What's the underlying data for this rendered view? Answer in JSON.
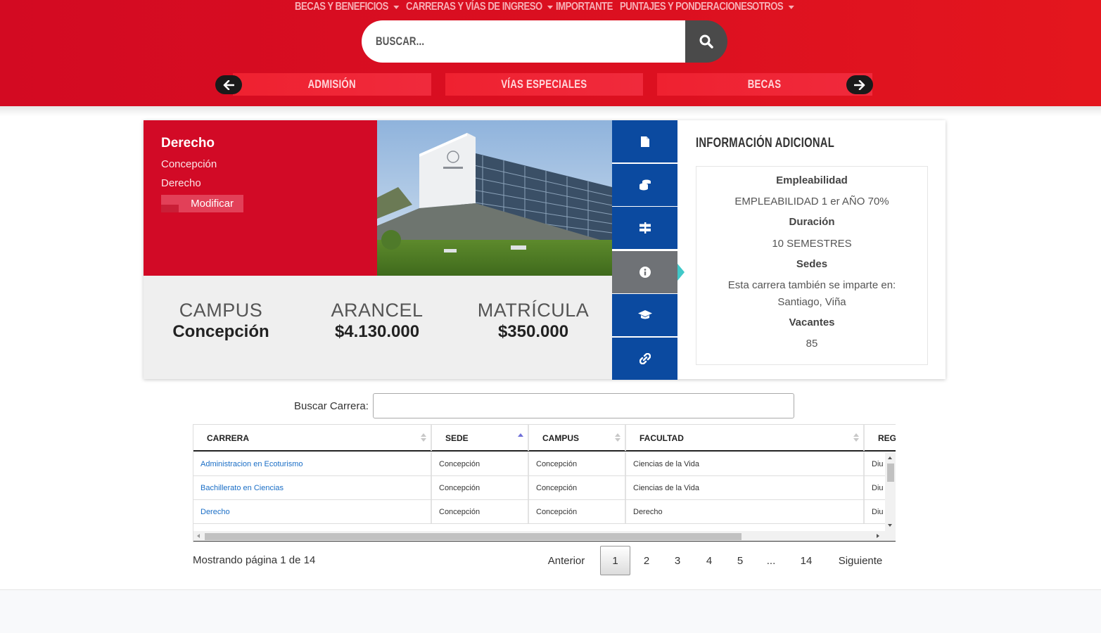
{
  "topnav": {
    "items": [
      {
        "label": "BECAS Y BENEFICIOS",
        "dropdown": true
      },
      {
        "label": "CARRERAS Y VÍAS DE INGRESO",
        "dropdown": true
      },
      {
        "label": "IMPORTANTE",
        "dropdown": false
      },
      {
        "label": "PUNTAJES Y PONDERACIONES",
        "dropdown": false
      },
      {
        "label": "OTROS",
        "dropdown": true
      }
    ]
  },
  "search": {
    "placeholder": "BUSCAR..."
  },
  "quick_tabs": [
    "ADMISIÓN",
    "VÍAS ESPECIALES",
    "BECAS"
  ],
  "career": {
    "name": "Derecho",
    "location": "Concepción",
    "faculty": "Derecho",
    "modify_label": "Modificar"
  },
  "stats": [
    {
      "label": "CAMPUS",
      "value": "Concepción"
    },
    {
      "label": "ARANCEL",
      "value": "$4.130.000"
    },
    {
      "label": "MATRÍCULA",
      "value": "$350.000"
    }
  ],
  "side_tabs": [
    "document-icon",
    "coins-icon",
    "signpost-icon",
    "info-icon",
    "graduation-cap-icon",
    "link-icon"
  ],
  "info": {
    "title": "INFORMACIÓN ADICIONAL",
    "employability_heading": "Empleabilidad",
    "employability_value": "EMPLEABILIDAD 1 er AÑO 70%",
    "duration_heading": "Duración",
    "duration_value": "10 SEMESTRES",
    "sedes_heading": "Sedes",
    "sedes_line1": "Esta carrera también se imparte en:",
    "sedes_line2": "Santiago, Viña",
    "vacancies_heading": "Vacantes",
    "vacancies_value": "85"
  },
  "table": {
    "search_label": "Buscar Carrera:",
    "columns": [
      "CARRERA",
      "SEDE",
      "CAMPUS",
      "FACULTAD",
      "REGI"
    ],
    "rows": [
      [
        "Administracion en Ecoturismo",
        "Concepción",
        "Concepción",
        "Ciencias de la Vida",
        "Diu"
      ],
      [
        "Bachillerato en Ciencias",
        "Concepción",
        "Concepción",
        "Ciencias de la Vida",
        "Diu"
      ],
      [
        "Derecho",
        "Concepción",
        "Concepción",
        "Derecho",
        "Diu"
      ]
    ]
  },
  "pagination": {
    "info": "Mostrando página 1 de 14",
    "previous": "Anterior",
    "pages": [
      "1",
      "2",
      "3",
      "4",
      "5",
      "...",
      "14"
    ],
    "next": "Siguiente"
  },
  "colors": {
    "header_red": "#d30a22",
    "tab_blue": "#0b4aa0",
    "active_tab": "#6f7276",
    "link_blue": "#1a6ec6"
  }
}
